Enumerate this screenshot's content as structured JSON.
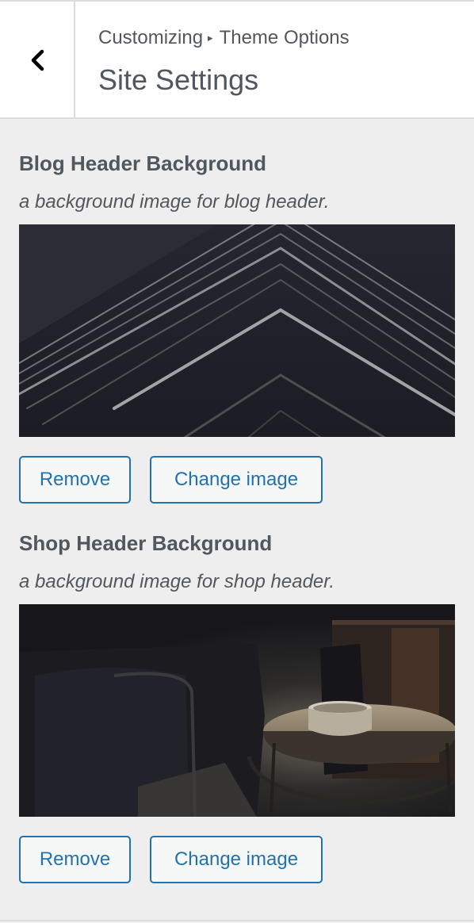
{
  "header": {
    "breadcrumb_root": "Customizing",
    "breadcrumb_separator": "▸",
    "breadcrumb_section": "Theme Options",
    "title": "Site Settings",
    "back_icon": "chevron-left-icon"
  },
  "controls": [
    {
      "title": "Blog Header Background",
      "description": "a background image for blog header.",
      "remove_label": "Remove",
      "change_label": "Change image"
    },
    {
      "title": "Shop Header Background",
      "description": "a background image for shop header.",
      "remove_label": "Remove",
      "change_label": "Change image"
    }
  ],
  "colors": {
    "accent": "#2271b1",
    "text": "#50575e",
    "panel_bg": "#eeeeee",
    "header_bg": "#ffffff"
  }
}
